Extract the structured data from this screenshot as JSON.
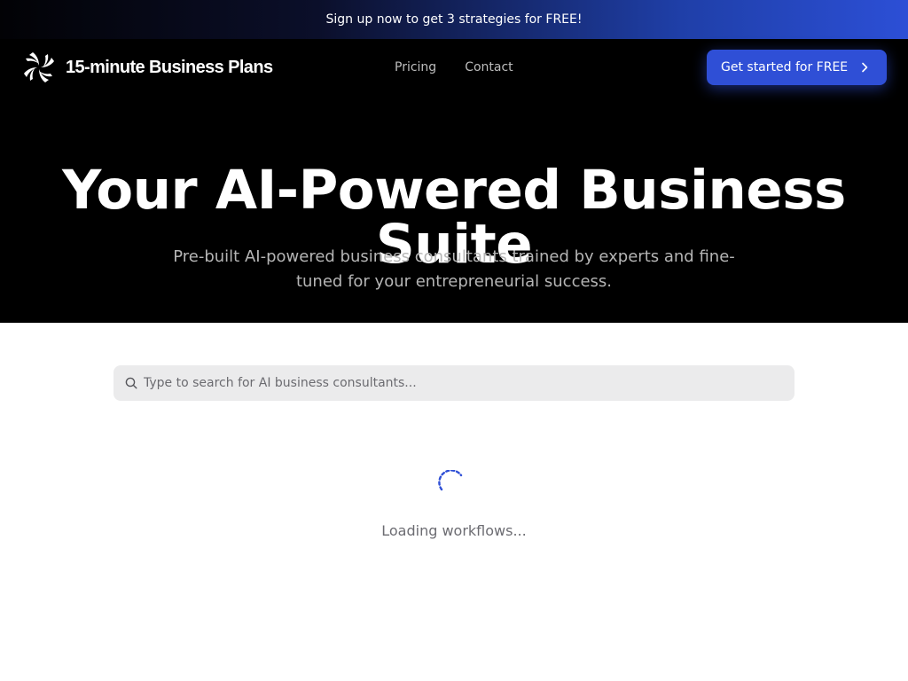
{
  "banner": {
    "text": "Sign up now to get 3 strategies for FREE!"
  },
  "brand": {
    "name": "15-minute Business Plans",
    "logo_icon": "pinwheel-logo-icon"
  },
  "nav": {
    "links": [
      {
        "label": "Pricing"
      },
      {
        "label": "Contact"
      }
    ]
  },
  "cta": {
    "label": "Get started for FREE",
    "icon": "chevron-right-icon"
  },
  "hero": {
    "title_line1": "Your AI-Powered Business",
    "title_line2": "Suite",
    "subtitle_line1": "Pre-built AI-powered business consultants trained by experts and fine-",
    "subtitle_line2": "tuned for your entrepreneurial success."
  },
  "search": {
    "placeholder": "Type to search for AI business consultants...",
    "value": "",
    "icon": "search-icon"
  },
  "loading": {
    "text": "Loading workflows...",
    "spinner_icon": "loading-spinner-icon"
  },
  "colors": {
    "accent": "#2f4fd6",
    "hero_bg": "#000000",
    "search_bg": "#ebebec"
  }
}
